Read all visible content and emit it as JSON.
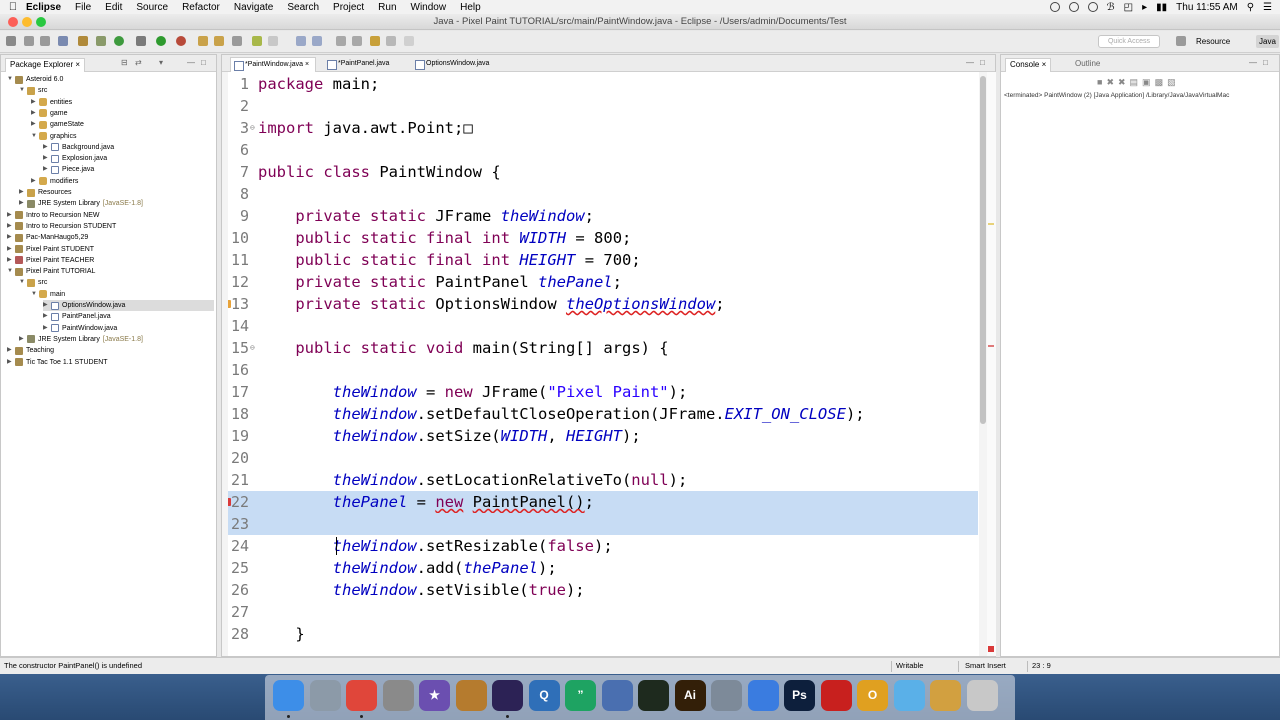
{
  "menubar": {
    "app": "Eclipse",
    "items": [
      "File",
      "Edit",
      "Source",
      "Refactor",
      "Navigate",
      "Search",
      "Project",
      "Run",
      "Window",
      "Help"
    ],
    "clock": "Thu 11:55 AM"
  },
  "window": {
    "title": "Java - Pixel Paint TUTORIAL/src/main/PaintWindow.java - Eclipse - /Users/admin/Documents/Test"
  },
  "toolbar": {
    "quick_access_placeholder": "Quick Access",
    "perspective_resource": "Resource",
    "perspective_java": "Java"
  },
  "package_explorer": {
    "tab_label": "Package Explorer",
    "tree": [
      {
        "label": "Asteroid 6.0",
        "indent": 0,
        "icon": "project-icon",
        "expanded": true
      },
      {
        "label": "src",
        "indent": 1,
        "icon": "folder-icon",
        "expanded": true
      },
      {
        "label": "entities",
        "indent": 2,
        "icon": "package-icon"
      },
      {
        "label": "game",
        "indent": 2,
        "icon": "package-icon"
      },
      {
        "label": "gameState",
        "indent": 2,
        "icon": "package-icon"
      },
      {
        "label": "graphics",
        "indent": 2,
        "icon": "package-icon",
        "expanded": true
      },
      {
        "label": "Background.java",
        "indent": 3,
        "icon": "java-file-icon"
      },
      {
        "label": "Explosion.java",
        "indent": 3,
        "icon": "java-file-icon"
      },
      {
        "label": "Piece.java",
        "indent": 3,
        "icon": "java-file-icon"
      },
      {
        "label": "modifiers",
        "indent": 2,
        "icon": "package-icon"
      },
      {
        "label": "Resources",
        "indent": 1,
        "icon": "folder-icon"
      },
      {
        "label": "JRE System Library",
        "deco": "[JavaSE-1.8]",
        "indent": 1,
        "icon": "library-icon"
      },
      {
        "label": "Intro to Recursion NEW",
        "indent": 0,
        "icon": "project-icon"
      },
      {
        "label": "Intro to Recursion STUDENT",
        "indent": 0,
        "icon": "project-icon"
      },
      {
        "label": "Pac-ManHaugo5,29",
        "indent": 0,
        "icon": "project-icon"
      },
      {
        "label": "Pixel Paint STUDENT",
        "indent": 0,
        "icon": "project-icon"
      },
      {
        "label": "Pixel Paint TEACHER",
        "indent": 0,
        "icon": "project-error-icon"
      },
      {
        "label": "Pixel Paint TUTORIAL",
        "indent": 0,
        "icon": "project-icon",
        "expanded": true
      },
      {
        "label": "src",
        "indent": 1,
        "icon": "folder-icon",
        "expanded": true
      },
      {
        "label": "main",
        "indent": 2,
        "icon": "package-icon",
        "expanded": true
      },
      {
        "label": "OptionsWindow.java",
        "indent": 3,
        "icon": "java-file-icon",
        "selected": true
      },
      {
        "label": "PaintPanel.java",
        "indent": 3,
        "icon": "java-file-icon"
      },
      {
        "label": "PaintWindow.java",
        "indent": 3,
        "icon": "java-file-icon"
      },
      {
        "label": "JRE System Library",
        "deco": "[JavaSE-1.8]",
        "indent": 1,
        "icon": "library-icon"
      },
      {
        "label": "Teaching",
        "indent": 0,
        "icon": "project-icon"
      },
      {
        "label": "Tic Tac Toe 1.1 STUDENT",
        "indent": 0,
        "icon": "project-icon"
      }
    ]
  },
  "editor": {
    "tabs": [
      {
        "label": "*PaintWindow.java",
        "active": true
      },
      {
        "label": "*PaintPanel.java"
      },
      {
        "label": "OptionsWindow.java"
      }
    ],
    "lines": [
      {
        "n": "1",
        "tokens": [
          {
            "t": "package",
            "c": "kw"
          },
          {
            "t": " main;"
          }
        ]
      },
      {
        "n": "2",
        "tokens": []
      },
      {
        "n": "3",
        "tokens": [
          {
            "t": "import",
            "c": "kw"
          },
          {
            "t": " java.awt.Point;"
          },
          {
            "t": "□"
          }
        ],
        "fold": true
      },
      {
        "n": "6",
        "tokens": []
      },
      {
        "n": "7",
        "tokens": [
          {
            "t": "public",
            "c": "kw"
          },
          {
            "t": " "
          },
          {
            "t": "class",
            "c": "kw"
          },
          {
            "t": " PaintWindow {"
          }
        ]
      },
      {
        "n": "8",
        "tokens": []
      },
      {
        "n": "9",
        "tokens": [
          {
            "t": "    "
          },
          {
            "t": "private",
            "c": "kw"
          },
          {
            "t": " "
          },
          {
            "t": "static",
            "c": "kw"
          },
          {
            "t": " JFrame "
          },
          {
            "t": "theWindow",
            "c": "fld"
          },
          {
            "t": ";"
          }
        ]
      },
      {
        "n": "10",
        "tokens": [
          {
            "t": "    "
          },
          {
            "t": "public",
            "c": "kw"
          },
          {
            "t": " "
          },
          {
            "t": "static",
            "c": "kw"
          },
          {
            "t": " "
          },
          {
            "t": "final",
            "c": "kw"
          },
          {
            "t": " "
          },
          {
            "t": "int",
            "c": "kw"
          },
          {
            "t": " "
          },
          {
            "t": "WIDTH",
            "c": "fld"
          },
          {
            "t": " = 800;"
          }
        ]
      },
      {
        "n": "11",
        "tokens": [
          {
            "t": "    "
          },
          {
            "t": "public",
            "c": "kw"
          },
          {
            "t": " "
          },
          {
            "t": "static",
            "c": "kw"
          },
          {
            "t": " "
          },
          {
            "t": "final",
            "c": "kw"
          },
          {
            "t": " "
          },
          {
            "t": "int",
            "c": "kw"
          },
          {
            "t": " "
          },
          {
            "t": "HEIGHT",
            "c": "fld"
          },
          {
            "t": " = 700;"
          }
        ]
      },
      {
        "n": "12",
        "tokens": [
          {
            "t": "    "
          },
          {
            "t": "private",
            "c": "kw"
          },
          {
            "t": " "
          },
          {
            "t": "static",
            "c": "kw"
          },
          {
            "t": " PaintPanel "
          },
          {
            "t": "thePanel",
            "c": "fld"
          },
          {
            "t": ";"
          }
        ]
      },
      {
        "n": "13",
        "tokens": [
          {
            "t": "    "
          },
          {
            "t": "private",
            "c": "kw"
          },
          {
            "t": " "
          },
          {
            "t": "static",
            "c": "kw"
          },
          {
            "t": " OptionsWindow "
          },
          {
            "t": "theOptionsWindow",
            "c": "fld",
            "u": true
          },
          {
            "t": ";"
          }
        ],
        "marker": "warning"
      },
      {
        "n": "14",
        "tokens": []
      },
      {
        "n": "15",
        "tokens": [
          {
            "t": "    "
          },
          {
            "t": "public",
            "c": "kw"
          },
          {
            "t": " "
          },
          {
            "t": "static",
            "c": "kw"
          },
          {
            "t": " "
          },
          {
            "t": "void",
            "c": "kw"
          },
          {
            "t": " main(String[] args) {"
          }
        ],
        "fold": true
      },
      {
        "n": "16",
        "tokens": []
      },
      {
        "n": "17",
        "tokens": [
          {
            "t": "        "
          },
          {
            "t": "theWindow",
            "c": "fld"
          },
          {
            "t": " = "
          },
          {
            "t": "new",
            "c": "kw"
          },
          {
            "t": " JFrame("
          },
          {
            "t": "\"Pixel Paint\"",
            "c": "str"
          },
          {
            "t": ");"
          }
        ]
      },
      {
        "n": "18",
        "tokens": [
          {
            "t": "        "
          },
          {
            "t": "theWindow",
            "c": "fld"
          },
          {
            "t": ".setDefaultCloseOperation(JFrame."
          },
          {
            "t": "EXIT_ON_CLOSE",
            "c": "fld"
          },
          {
            "t": ");"
          }
        ]
      },
      {
        "n": "19",
        "tokens": [
          {
            "t": "        "
          },
          {
            "t": "theWindow",
            "c": "fld"
          },
          {
            "t": ".setSize("
          },
          {
            "t": "WIDTH",
            "c": "fld"
          },
          {
            "t": ", "
          },
          {
            "t": "HEIGHT",
            "c": "fld"
          },
          {
            "t": ");"
          }
        ]
      },
      {
        "n": "20",
        "tokens": []
      },
      {
        "n": "21",
        "tokens": [
          {
            "t": "        "
          },
          {
            "t": "theWindow",
            "c": "fld"
          },
          {
            "t": ".setLocationRelativeTo("
          },
          {
            "t": "null",
            "c": "kw"
          },
          {
            "t": ");"
          }
        ]
      },
      {
        "n": "22",
        "tokens": [
          {
            "t": "        "
          },
          {
            "t": "thePanel",
            "c": "fld"
          },
          {
            "t": " = "
          },
          {
            "t": "new",
            "c": "kw",
            "u": true
          },
          {
            "t": " "
          },
          {
            "t": "PaintPanel()",
            "u": true
          },
          {
            "t": ";"
          }
        ],
        "marker": "error",
        "highlight": true
      },
      {
        "n": "23",
        "tokens": [
          {
            "t": "        "
          }
        ],
        "highlight": true
      },
      {
        "n": "24",
        "tokens": [
          {
            "t": "        "
          },
          {
            "t": "theWindow",
            "c": "fld"
          },
          {
            "t": ".setResizable("
          },
          {
            "t": "false",
            "c": "kw"
          },
          {
            "t": ");"
          }
        ]
      },
      {
        "n": "25",
        "tokens": [
          {
            "t": "        "
          },
          {
            "t": "theWindow",
            "c": "fld"
          },
          {
            "t": ".add("
          },
          {
            "t": "thePanel",
            "c": "fld"
          },
          {
            "t": ");"
          }
        ]
      },
      {
        "n": "26",
        "tokens": [
          {
            "t": "        "
          },
          {
            "t": "theWindow",
            "c": "fld"
          },
          {
            "t": ".setVisible("
          },
          {
            "t": "true",
            "c": "kw"
          },
          {
            "t": ");"
          }
        ]
      },
      {
        "n": "27",
        "tokens": []
      },
      {
        "n": "28",
        "tokens": [
          {
            "t": "    }"
          }
        ]
      }
    ]
  },
  "console_view": {
    "tab_console": "Console",
    "tab_outline": "Outline",
    "status": "<terminated> PaintWindow (2) [Java Application] /Library/Java/JavaVirtualMac"
  },
  "statusbar": {
    "message": "The constructor PaintPanel() is undefined",
    "mode": "Writable",
    "insert": "Smart Insert",
    "position": "23 : 9"
  },
  "dock": {
    "apps": [
      {
        "name": "finder-icon",
        "label": "",
        "color": "#3d8ee8",
        "running": true
      },
      {
        "name": "launchpad-icon",
        "label": "",
        "color": "#8c9aa8"
      },
      {
        "name": "chrome-icon",
        "label": "",
        "color": "#e0463a",
        "running": true
      },
      {
        "name": "calculator-icon",
        "label": "",
        "color": "#8a8a8a"
      },
      {
        "name": "imovie-icon",
        "label": "★",
        "color": "#6b4fb0"
      },
      {
        "name": "garageband-icon",
        "label": "",
        "color": "#b57b2e"
      },
      {
        "name": "eclipse-icon",
        "label": "",
        "color": "#2c2255",
        "running": true
      },
      {
        "name": "quicktime-icon",
        "label": "Q",
        "color": "#2f6fb8"
      },
      {
        "name": "hangouts-icon",
        "label": "”",
        "color": "#1ea362"
      },
      {
        "name": "grid-icon",
        "label": "",
        "color": "#4a6fb0"
      },
      {
        "name": "activity-monitor-icon",
        "label": "",
        "color": "#1e2a1e"
      },
      {
        "name": "illustrator-icon",
        "label": "Ai",
        "color": "#331f08"
      },
      {
        "name": "utilities-icon",
        "label": "",
        "color": "#7d8a99"
      },
      {
        "name": "textedit-icon",
        "label": "",
        "color": "#3a7ce0"
      },
      {
        "name": "photoshop-icon",
        "label": "Ps",
        "color": "#0d1f3c"
      },
      {
        "name": "acrobat-icon",
        "label": "",
        "color": "#c8201e"
      },
      {
        "name": "o-app-icon",
        "label": "O",
        "color": "#e0a020"
      },
      {
        "name": "applications-folder-icon",
        "label": "",
        "color": "#5ab0e8"
      },
      {
        "name": "downloads-stack-icon",
        "label": "",
        "color": "#d2a040"
      },
      {
        "name": "trash-icon",
        "label": "",
        "color": "#c8c8c8"
      }
    ]
  },
  "colors": {
    "keyword": "#7f0055",
    "field": "#0000c0",
    "string": "#2a00ff",
    "selection": "#c7dcf4"
  }
}
